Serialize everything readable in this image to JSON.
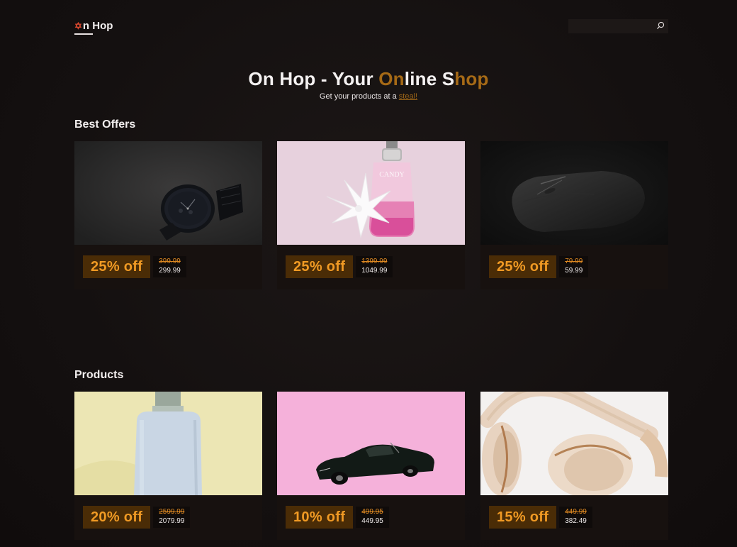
{
  "header": {
    "logo_star": "✡",
    "logo_text": "n Hop",
    "search_placeholder": ""
  },
  "hero": {
    "title_parts": [
      "On Hop - Your ",
      "On",
      "line ",
      "S",
      "hop"
    ],
    "subtitle_prefix": "Get your products at a ",
    "subtitle_link": "steal!"
  },
  "sections": {
    "best_offers_title": "Best Offers",
    "products_title": "Products"
  },
  "best_offers": [
    {
      "product": "watch",
      "discount": "25% off",
      "old_price": "399.99",
      "new_price": "299.99"
    },
    {
      "product": "perfume-candy",
      "discount": "25% off",
      "old_price": "1399.99",
      "new_price": "1049.99"
    },
    {
      "product": "mouse",
      "discount": "25% off",
      "old_price": "79.99",
      "new_price": "59.99"
    }
  ],
  "products": [
    {
      "product": "cologne-bottle",
      "discount": "20% off",
      "old_price": "2599.99",
      "new_price": "2079.99"
    },
    {
      "product": "toy-car",
      "discount": "10% off",
      "old_price": "499.95",
      "new_price": "449.95"
    },
    {
      "product": "headphones",
      "discount": "15% off",
      "old_price": "449.99",
      "new_price": "382.49"
    }
  ],
  "colors": {
    "background": "#141010",
    "accent_brown": "#a66a16",
    "discount_bg": "#4a2c06",
    "discount_text": "#f09a24"
  }
}
